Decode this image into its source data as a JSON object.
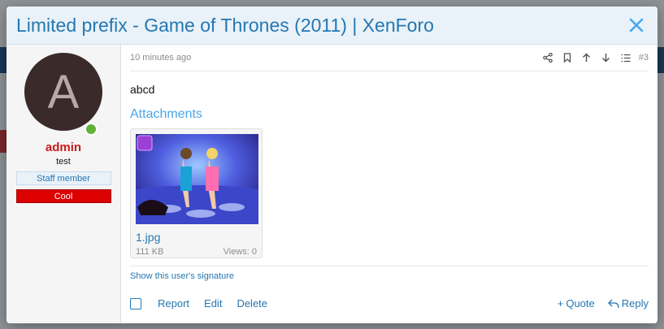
{
  "overlay": {
    "title": "Limited prefix - Game of Thrones (2011) | XenForo",
    "close_icon": "close-icon"
  },
  "user": {
    "avatar_letter": "A",
    "name": "admin",
    "title": "test",
    "banners": [
      "Staff member",
      "Cool"
    ]
  },
  "post": {
    "date": "10 minutes ago",
    "number": "#3",
    "body": "abcd",
    "attachments_label": "Attachments",
    "attachment": {
      "filename": "1.jpg",
      "size": "111 KB",
      "views": "Views: 0"
    },
    "signature_link": "Show this user's signature",
    "actions": {
      "report": "Report",
      "edit": "Edit",
      "delete": "Delete",
      "quote": "Quote",
      "reply": "Reply"
    }
  },
  "colors": {
    "accent": "#2577b1",
    "header_bg": "#e9f2f9",
    "username": "#c41c1c",
    "cool_banner": "#dc0000"
  }
}
